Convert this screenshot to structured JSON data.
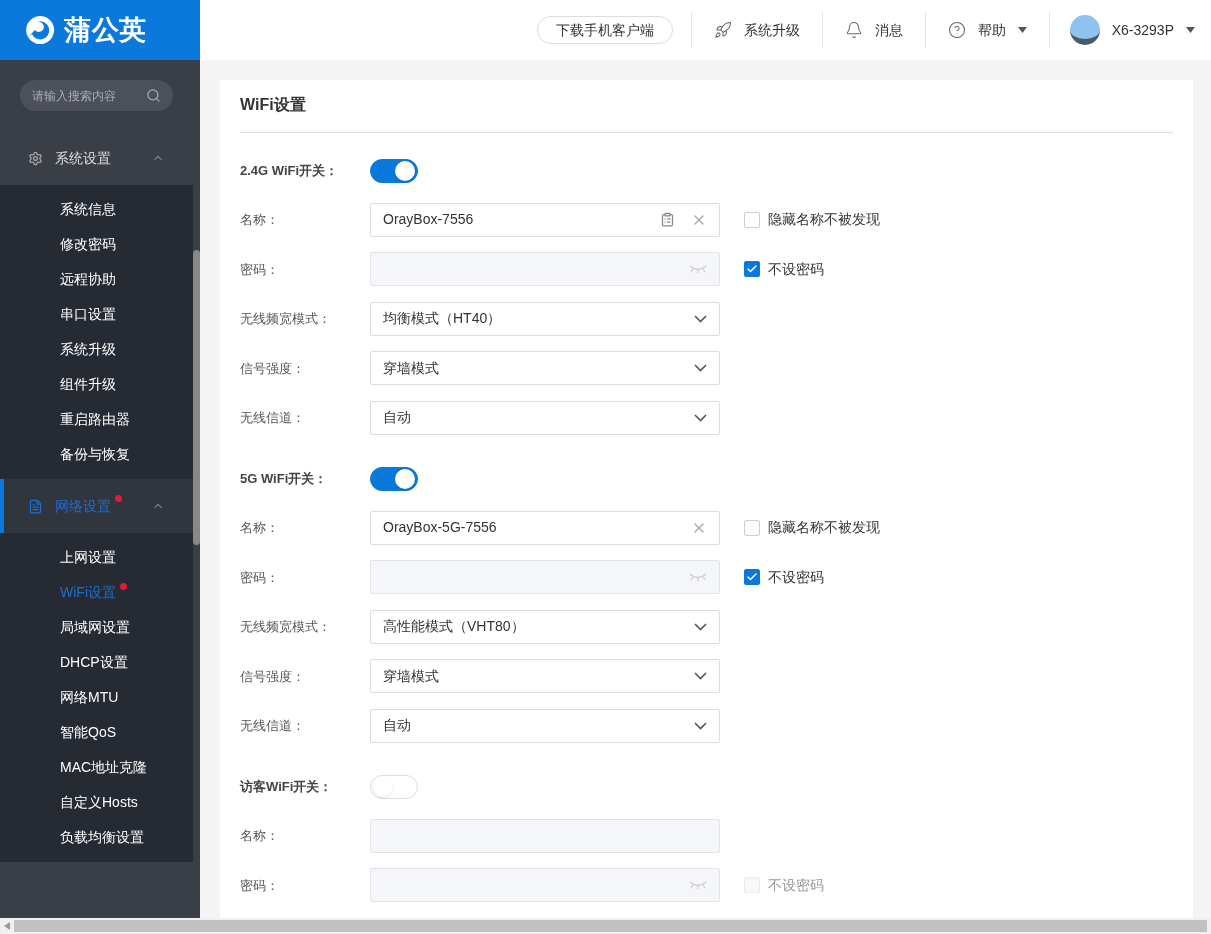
{
  "logo": {
    "text": "蒲公英"
  },
  "search": {
    "placeholder": "请输入搜索内容"
  },
  "nav": [
    {
      "label": "系统设置",
      "expanded": true,
      "selected": false,
      "dot": false,
      "children": [
        {
          "label": "系统信息",
          "selected": false,
          "dot": false
        },
        {
          "label": "修改密码",
          "selected": false,
          "dot": false
        },
        {
          "label": "远程协助",
          "selected": false,
          "dot": false
        },
        {
          "label": "串口设置",
          "selected": false,
          "dot": false
        },
        {
          "label": "系统升级",
          "selected": false,
          "dot": false
        },
        {
          "label": "组件升级",
          "selected": false,
          "dot": false
        },
        {
          "label": "重启路由器",
          "selected": false,
          "dot": false
        },
        {
          "label": "备份与恢复",
          "selected": false,
          "dot": false
        }
      ]
    },
    {
      "label": "网络设置",
      "expanded": true,
      "selected": true,
      "dot": true,
      "children": [
        {
          "label": "上网设置",
          "selected": false,
          "dot": false
        },
        {
          "label": "WiFi设置",
          "selected": true,
          "dot": true
        },
        {
          "label": "局域网设置",
          "selected": false,
          "dot": false
        },
        {
          "label": "DHCP设置",
          "selected": false,
          "dot": false
        },
        {
          "label": "网络MTU",
          "selected": false,
          "dot": false
        },
        {
          "label": "智能QoS",
          "selected": false,
          "dot": false
        },
        {
          "label": "MAC地址克隆",
          "selected": false,
          "dot": false
        },
        {
          "label": "自定义Hosts",
          "selected": false,
          "dot": false
        },
        {
          "label": "负载均衡设置",
          "selected": false,
          "dot": false
        }
      ]
    }
  ],
  "header": {
    "download": "下载手机客户端",
    "actions": [
      {
        "label": "系统升级",
        "caret": false
      },
      {
        "label": "消息",
        "caret": false
      },
      {
        "label": "帮助",
        "caret": true
      }
    ],
    "device": "X6-3293P"
  },
  "page": {
    "title": "WiFi设置",
    "sections": [
      {
        "label": "2.4G WiFi开关：",
        "on": true,
        "fields": [
          {
            "kind": "text",
            "label": "名称：",
            "value": "OrayBox-7556",
            "disabled": false,
            "scan": true,
            "clear": true,
            "checkbox": {
              "label": "隐藏名称不被发现",
              "checked": false,
              "disabled": false
            }
          },
          {
            "kind": "password",
            "label": "密码：",
            "disabled": true,
            "checkbox": {
              "label": "不设密码",
              "checked": true,
              "disabled": false
            }
          },
          {
            "kind": "select",
            "label": "无线频宽模式：",
            "value": "均衡模式（HT40）"
          },
          {
            "kind": "select",
            "label": "信号强度：",
            "value": "穿墙模式"
          },
          {
            "kind": "select",
            "label": "无线信道：",
            "value": "自动"
          }
        ]
      },
      {
        "label": "5G WiFi开关：",
        "on": true,
        "fields": [
          {
            "kind": "text",
            "label": "名称：",
            "value": "OrayBox-5G-7556",
            "disabled": false,
            "scan": false,
            "clear": true,
            "checkbox": {
              "label": "隐藏名称不被发现",
              "checked": false,
              "disabled": false
            }
          },
          {
            "kind": "password",
            "label": "密码：",
            "disabled": true,
            "checkbox": {
              "label": "不设密码",
              "checked": true,
              "disabled": false
            }
          },
          {
            "kind": "select",
            "label": "无线频宽模式：",
            "value": "高性能模式（VHT80）"
          },
          {
            "kind": "select",
            "label": "信号强度：",
            "value": "穿墙模式"
          },
          {
            "kind": "select",
            "label": "无线信道：",
            "value": "自动"
          }
        ]
      },
      {
        "label": "访客WiFi开关：",
        "on": false,
        "fields": [
          {
            "kind": "text",
            "label": "名称：",
            "disabled": true,
            "scan": false,
            "clear": false
          },
          {
            "kind": "password",
            "label": "密码：",
            "disabled": true,
            "checkbox": {
              "label": "不设密码",
              "checked": false,
              "disabled": true
            }
          }
        ]
      }
    ]
  }
}
